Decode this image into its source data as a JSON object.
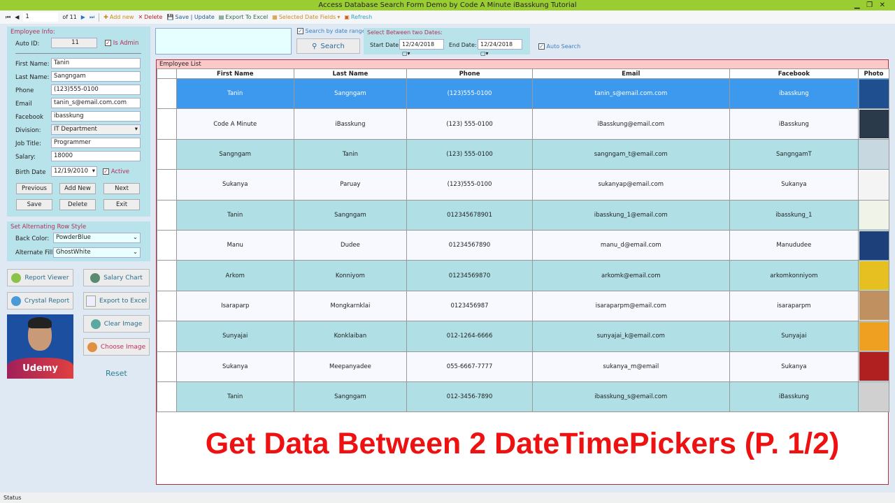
{
  "title": "Access Database Search Form Demo by Code A Minute iBasskung Tutorial",
  "toolbar": {
    "position": "1",
    "of": "of 11",
    "add": "Add new",
    "delete": "Delete",
    "save": "Save | Update",
    "export": "Export To Excel",
    "date_fields": "Selected Date Fields",
    "refresh": "Refresh"
  },
  "info": {
    "title": "Employee Info:",
    "auto_id_label": "Auto ID:",
    "auto_id": "11",
    "is_admin": "Is Admin",
    "fields": [
      {
        "label": "First Name:",
        "value": "Tanin"
      },
      {
        "label": "Last Name:",
        "value": "Sangngam"
      },
      {
        "label": "Phone",
        "value": "(123)555-0100"
      },
      {
        "label": "Email",
        "value": "tanin_s@email.com.com"
      },
      {
        "label": "Facebook",
        "value": "ibasskung"
      },
      {
        "label": "Division:",
        "value": "IT Department"
      },
      {
        "label": "Job Title:",
        "value": "Programmer"
      },
      {
        "label": "Salary:",
        "value": "18000"
      }
    ],
    "birth_label": "Birth Date",
    "birth": "12/19/2010",
    "active": "Active",
    "buttons": [
      "Previous",
      "Add New",
      "Next",
      "Save",
      "Delete",
      "Exit"
    ]
  },
  "rowstyle": {
    "title": "Set Alternating Row Style",
    "back_label": "Back Color:",
    "back": "PowderBlue",
    "alt_label": "Alternate Fill",
    "alt": "GhostWhite"
  },
  "actions": {
    "report_viewer": "Report Viewer",
    "salary_chart": "Salary Chart",
    "crystal": "Crystal Report",
    "export": "Export to Excel",
    "clear": "Clear Image",
    "choose": "Choose Image",
    "reset": "Reset",
    "photo_text": "Udemy"
  },
  "search": {
    "by_date": "Search by date range",
    "button": "Search",
    "range_title": "Select Between two Dates:",
    "start_label": "Start Date:",
    "start": "12/24/2018",
    "end_label": "End Date:",
    "end": "12/24/2018",
    "auto": "Auto Search"
  },
  "grid": {
    "title": "Employee List",
    "columns": [
      "First Name",
      "Last Name",
      "Phone",
      "Email",
      "Facebook",
      "Photo"
    ],
    "rows": [
      [
        "Tanin",
        "Sangngam",
        "(123)555-0100",
        "tanin_s@email.com.com",
        "ibasskung"
      ],
      [
        "Code A Minute",
        "iBasskung",
        "(123) 555-0100",
        "iBasskung@email.com",
        "iBasskung"
      ],
      [
        "Sangngam",
        "Tanin",
        "(123) 555-0100",
        "sangngam_t@email.com",
        "SangngamT"
      ],
      [
        "Sukanya",
        "Paruay",
        "(123)555-0100",
        "sukanyap@email.com",
        "Sukanya"
      ],
      [
        "Tanin",
        "Sangngam",
        "012345678901",
        "ibasskung_1@email.com",
        "ibasskung_1"
      ],
      [
        "Manu",
        "Dudee",
        "01234567890",
        "manu_d@email.com",
        "Manududee"
      ],
      [
        "Arkom",
        "Konniyom",
        "01234569870",
        "arkomk@email.com",
        "arkomkonniyom"
      ],
      [
        "Isaraparp",
        "Mongkarnklai",
        "0123456987",
        "isaraparpm@email.com",
        "isaraparpm"
      ],
      [
        "Sunyajai",
        "Konklaiban",
        "012-1264-6666",
        "sunyajai_k@email.com",
        "Sunyajai"
      ],
      [
        "Sukanya",
        "Meepanyadee",
        "055-6667-7777",
        "sukanya_m@email",
        "Sukanya"
      ],
      [
        "Tanin",
        "Sangngam",
        "012-3456-7890",
        "ibasskung_s@email.com",
        "iBasskung"
      ]
    ],
    "photo_colors": [
      "#1f4f8f",
      "#2a3a4a",
      "#c8d8e0",
      "#f4f4f4",
      "#f0f4e8",
      "#1d3f7a",
      "#e6c020",
      "#c09060",
      "#f0a020",
      "#b02020",
      "#d0d0d0"
    ]
  },
  "banner": "Get Data Between 2 DateTimePickers (P. 1/2)",
  "status": "Status"
}
